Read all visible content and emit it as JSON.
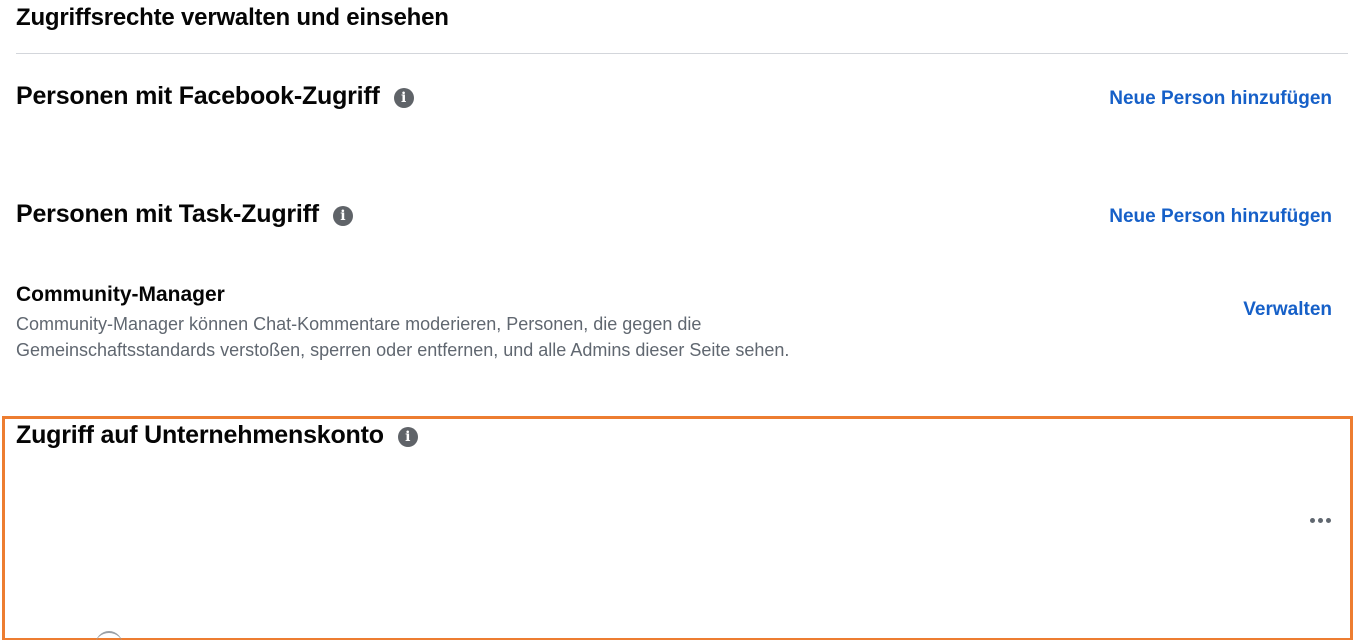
{
  "page": {
    "title": "Zugriffsrechte verwalten und einsehen"
  },
  "sections": {
    "facebook_access": {
      "title": "Personen mit Facebook-Zugriff",
      "action_label": "Neue Person hinzufügen"
    },
    "task_access": {
      "title": "Personen mit Task-Zugriff",
      "action_label": "Neue Person hinzufügen"
    },
    "community_manager": {
      "title": "Community-Manager",
      "description": "Community-Manager können Chat-Kommentare moderieren, Personen, die gegen die Gemeinschaftsstandards verstoßen, sperren oder entfernen, und alle Admins dieser Seite sehen.",
      "action_label": "Verwalten"
    },
    "business_account": {
      "title": "Zugriff auf Unternehmenskonto",
      "more_icon": "more-horizontal-icon"
    }
  },
  "icons": {
    "info": "i"
  },
  "colors": {
    "link": "#1660c8",
    "highlight": "#ed7d31",
    "icon_gray": "#5f6368"
  }
}
